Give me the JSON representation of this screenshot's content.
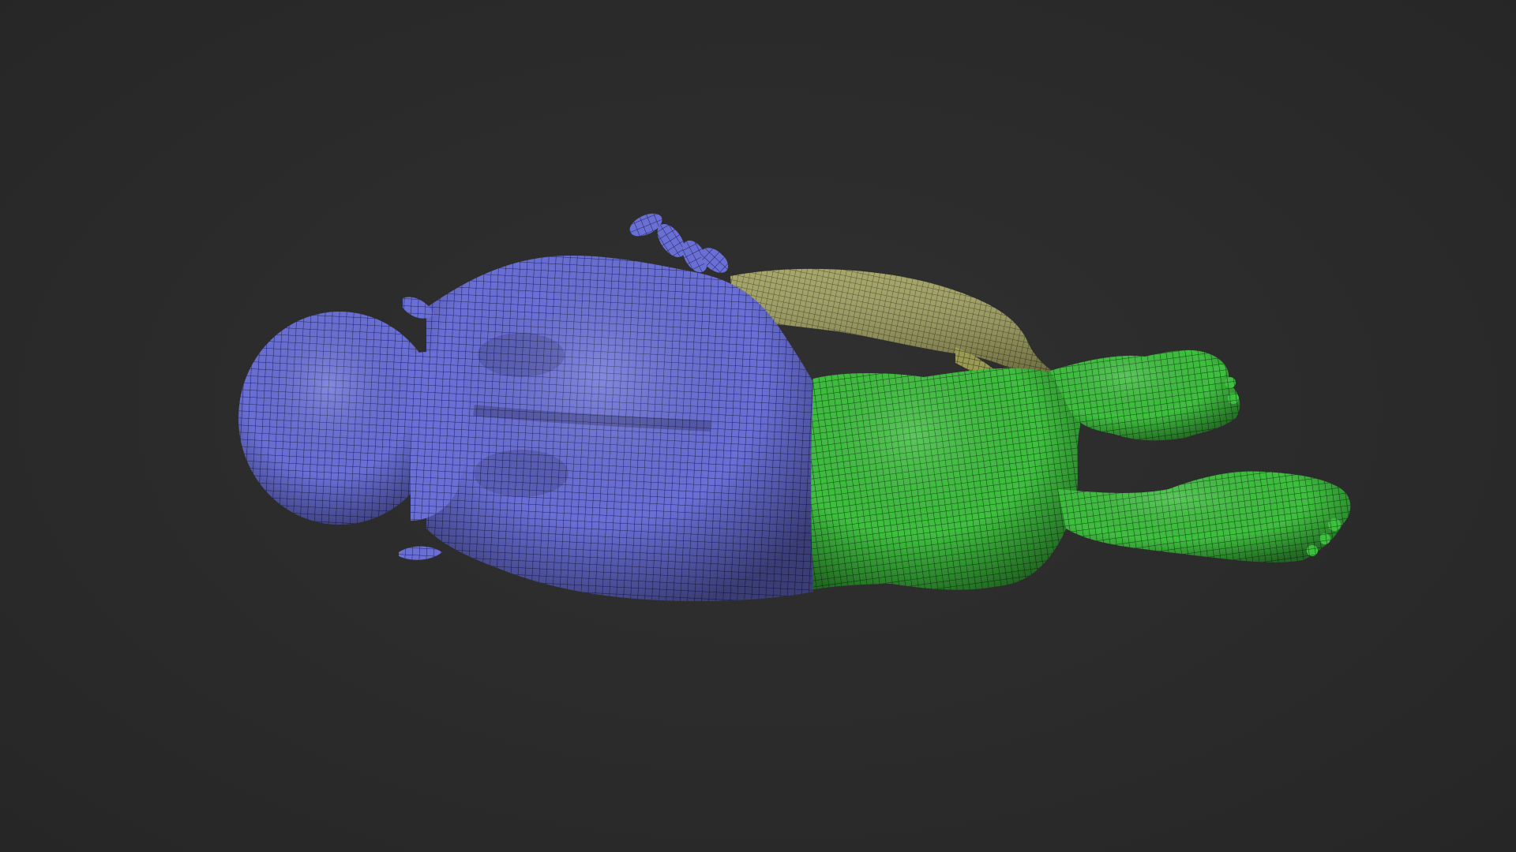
{
  "viewport": {
    "background_color": "#2b2b2b"
  },
  "model": {
    "polygroups": [
      {
        "name": "torso-head",
        "color": "#6a6fd6"
      },
      {
        "name": "arm",
        "color": "#9a9a55"
      },
      {
        "name": "legs",
        "color": "#3fbf3f"
      }
    ],
    "wireframe_color": "#1a1a1a"
  }
}
